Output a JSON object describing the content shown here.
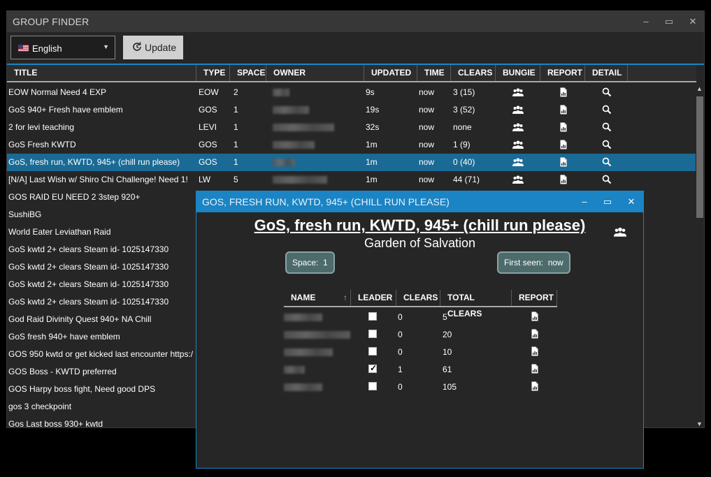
{
  "app": {
    "title": "GROUP FINDER"
  },
  "toolbar": {
    "language": "English",
    "update_label": "Update"
  },
  "window_controls": {
    "minimize": "–",
    "maximize": "▭",
    "close": "✕"
  },
  "columns": [
    "TITLE",
    "TYPE",
    "SPACE",
    "OWNER",
    "UPDATED",
    "TIME",
    "CLEARS",
    "BUNGIE",
    "REPORT",
    "DETAIL"
  ],
  "rows": [
    {
      "title": "EOW Normal Need 4 EXP",
      "type": "EOW",
      "space": "2",
      "updated": "9s",
      "time": "now",
      "clears": "3 (15)"
    },
    {
      "title": "GoS 940+ Fresh have emblem",
      "type": "GOS",
      "space": "1",
      "updated": "19s",
      "time": "now",
      "clears": "3 (52)"
    },
    {
      "title": "2 for levi teaching",
      "type": "LEVI",
      "space": "1",
      "updated": "32s",
      "time": "now",
      "clears": "none"
    },
    {
      "title": "GoS Fresh KWTD",
      "type": "GOS",
      "space": "1",
      "updated": "1m",
      "time": "now",
      "clears": "1 (9)"
    },
    {
      "title": "GoS, fresh run, KWTD, 945+ (chill run please)",
      "type": "GOS",
      "space": "1",
      "updated": "1m",
      "time": "now",
      "clears": "0 (40)",
      "selected": true
    },
    {
      "title": "[N/A] Last Wish w/ Shiro Chi Challenge! Need 1!",
      "type": "LW",
      "space": "5",
      "updated": "1m",
      "time": "now",
      "clears": "44 (71)"
    },
    {
      "title": "GOS RAID EU NEED 2 3step 920+"
    },
    {
      "title": "SushiBG"
    },
    {
      "title": "World Eater Leviathan Raid"
    },
    {
      "title": "GoS kwtd 2+ clears Steam id- 1025147330"
    },
    {
      "title": "GoS kwtd 2+ clears Steam id- 1025147330"
    },
    {
      "title": "GoS kwtd 2+ clears Steam id- 1025147330"
    },
    {
      "title": "GoS kwtd 2+ clears Steam id- 1025147330"
    },
    {
      "title": "God Raid Divinity Quest 940+ NA Chill"
    },
    {
      "title": "GoS fresh 940+ have emblem"
    },
    {
      "title": "GOS 950 kwtd or get kicked last encounter https:/"
    },
    {
      "title": "GOS Boss - KWTD preferred"
    },
    {
      "title": "GOS Harpy boss fight, Need good DPS"
    },
    {
      "title": "gos 3 checkpoint"
    },
    {
      "title": "Gos Last boss 930+ kwtd"
    }
  ],
  "detail": {
    "window_title": "GOS, FRESH RUN, KWTD, 945+ (CHILL RUN PLEASE)",
    "heading": "GoS, fresh run, KWTD, 945+ (chill run please)",
    "activity": "Garden of Salvation",
    "space_label": "Space:",
    "space_value": "1",
    "first_seen_label": "First seen:",
    "first_seen_value": "now",
    "member_columns": [
      "NAME",
      "LEADER",
      "CLEARS",
      "TOTAL CLEARS",
      "REPORT"
    ],
    "sort_arrow": "↑",
    "members": [
      {
        "leader": false,
        "clears": "0",
        "total": "5"
      },
      {
        "leader": false,
        "clears": "0",
        "total": "20"
      },
      {
        "leader": false,
        "clears": "0",
        "total": "10"
      },
      {
        "leader": true,
        "clears": "1",
        "total": "61"
      },
      {
        "leader": false,
        "clears": "0",
        "total": "105"
      }
    ]
  },
  "colors": {
    "accent": "#1b84c4",
    "selected_row": "#1a6a96",
    "pill": "#4d6b6b"
  },
  "icons": {
    "bungie": "group-icon",
    "report": "report-icon",
    "detail": "search-icon"
  }
}
